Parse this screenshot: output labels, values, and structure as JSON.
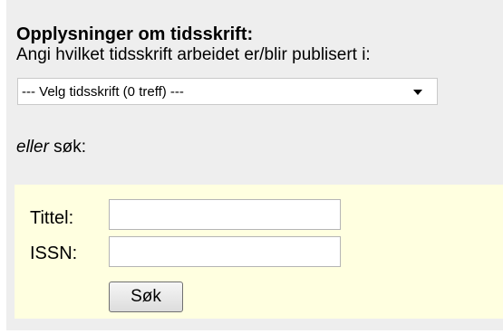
{
  "journal": {
    "heading": "Opplysninger om tidsskrift:",
    "intro": "Angi hvilket tidsskrift arbeidet er/blir publisert i:",
    "select_value": "--- Velg tidsskrift (0 treff) ---",
    "or_emphasis": "eller",
    "or_rest": " søk:"
  },
  "search": {
    "title_label": "Tittel:",
    "title_value": "",
    "issn_label": "ISSN:",
    "issn_value": "",
    "button_label": "Søk"
  },
  "colors": {
    "panel_bg": "#eeeeee",
    "search_bg": "#ffffe0"
  },
  "icons": {
    "select_arrow": "chevron-down-icon"
  }
}
